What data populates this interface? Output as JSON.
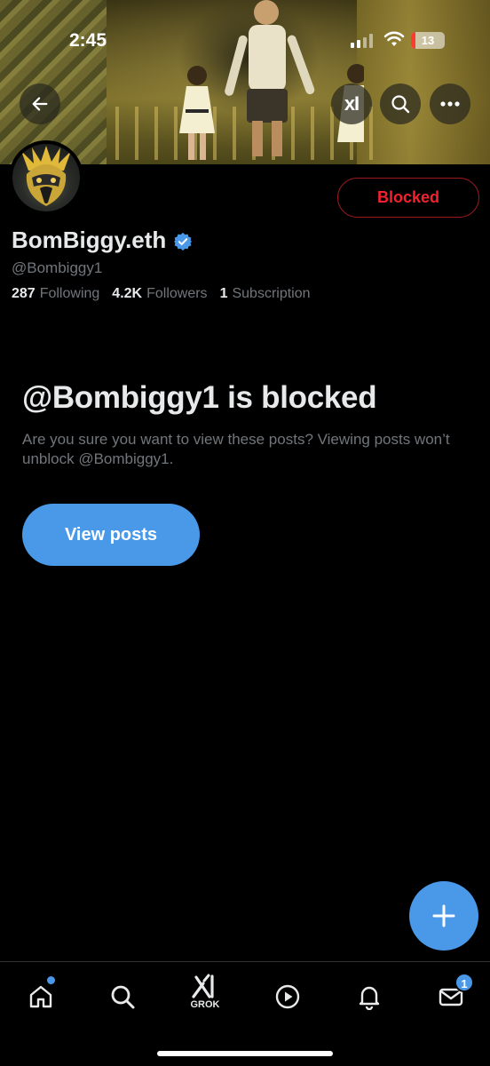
{
  "status_bar": {
    "time": "2:45",
    "battery_percent": "13",
    "battery_level": 0.13,
    "signal_icon": "signal-icon",
    "wifi_icon": "wifi-icon"
  },
  "header": {
    "back_icon": "arrow-left-icon",
    "xai_label": "xI",
    "search_icon": "search-icon",
    "more_icon": "more-horizontal-icon"
  },
  "profile": {
    "display_name": "BomBiggy.eth",
    "verified_icon": "verified-badge-icon",
    "handle": "@Bombiggy1",
    "blocked_button_label": "Blocked",
    "stats": [
      {
        "number": "287",
        "label": "Following"
      },
      {
        "number": "4.2K",
        "label": "Followers"
      },
      {
        "number": "1",
        "label": "Subscription"
      }
    ]
  },
  "blocked_notice": {
    "title": "@Bombiggy1 is blocked",
    "description": "Are you sure you want to view these posts? Viewing posts won’t unblock @Bombiggy1.",
    "button_label": "View posts"
  },
  "fab": {
    "icon": "plus-icon"
  },
  "bottom_nav": {
    "items": [
      {
        "name": "home",
        "icon": "home-icon"
      },
      {
        "name": "search",
        "icon": "search-icon"
      },
      {
        "name": "grok",
        "icon": "grok-icon",
        "label": "GROK"
      },
      {
        "name": "video",
        "icon": "play-circle-icon"
      },
      {
        "name": "notifications",
        "icon": "bell-icon"
      },
      {
        "name": "messages",
        "icon": "mail-icon",
        "badge": "1"
      }
    ]
  },
  "colors": {
    "accent": "#4a99e9",
    "blocked_red": "#f4212e",
    "secondary_text": "#71767b",
    "primary_text": "#e7e9ea",
    "background": "#000000"
  }
}
